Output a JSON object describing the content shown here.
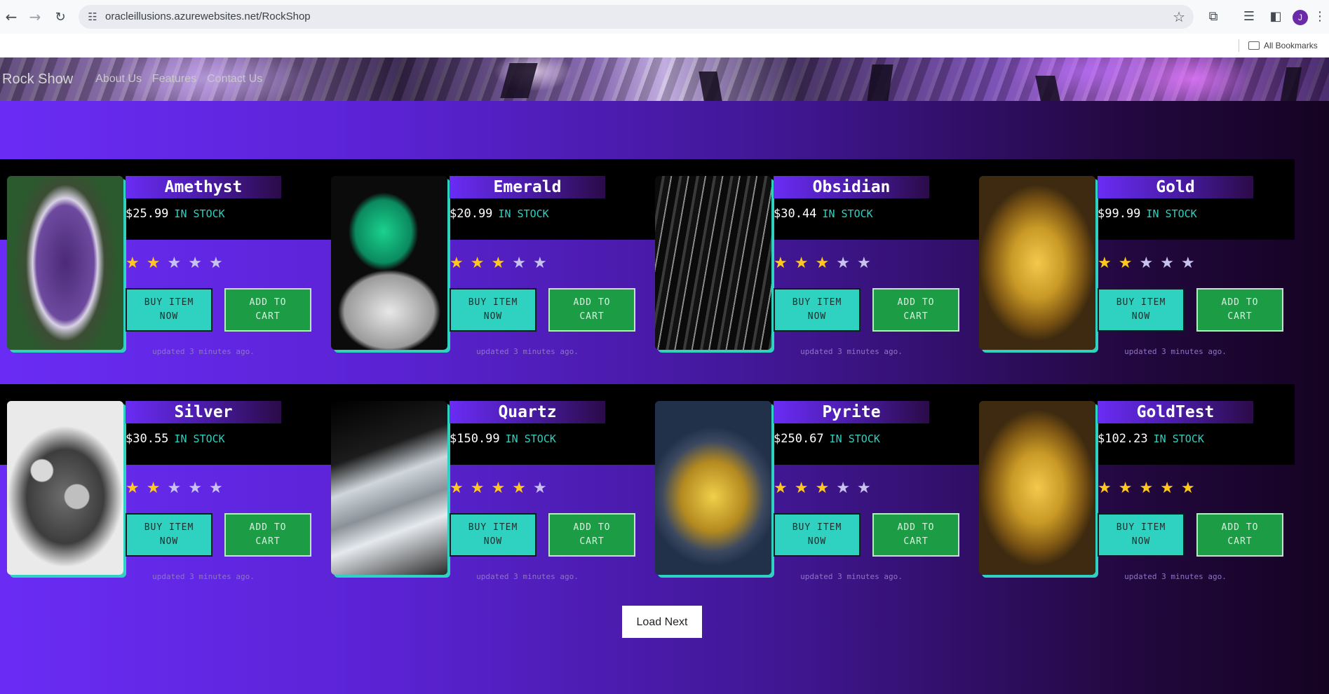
{
  "browser": {
    "url": "oracleillusions.azurewebsites.net/RockShop",
    "bookmarks_label": "All Bookmarks",
    "avatar_initial": "J",
    "icons": [
      "back-icon",
      "forward-icon",
      "reload-icon",
      "site-settings-icon",
      "bookmark-star-icon",
      "extensions-icon",
      "reading-list-icon",
      "side-panel-icon",
      "menu-icon"
    ]
  },
  "nav": {
    "brand": "Rock Show",
    "links": [
      "About Us",
      "Features",
      "Contact Us"
    ]
  },
  "products": [
    {
      "name": "Amethyst",
      "price": "$25.99",
      "stock": "IN STOCK",
      "rating": 2,
      "buy": "BUY ITEM NOW",
      "cart": "ADD TO CART",
      "updated": "updated 3 minutes ago."
    },
    {
      "name": "Emerald",
      "price": "$20.99",
      "stock": "IN STOCK",
      "rating": 3,
      "buy": "BUY ITEM NOW",
      "cart": "ADD TO CART",
      "updated": "updated 3 minutes ago."
    },
    {
      "name": "Obsidian",
      "price": "$30.44",
      "stock": "IN STOCK",
      "rating": 3,
      "buy": "BUY ITEM NOW",
      "cart": "ADD TO CART",
      "updated": "updated 3 minutes ago."
    },
    {
      "name": "Gold",
      "price": "$99.99",
      "stock": "IN STOCK",
      "rating": 2,
      "buy": "BUY ITEM NOW",
      "cart": "ADD TO CART",
      "updated": "updated 3 minutes ago."
    },
    {
      "name": "Silver",
      "price": "$30.55",
      "stock": "IN STOCK",
      "rating": 2,
      "buy": "BUY ITEM NOW",
      "cart": "ADD TO CART",
      "updated": "updated 3 minutes ago."
    },
    {
      "name": "Quartz",
      "price": "$150.99",
      "stock": "IN STOCK",
      "rating": 4,
      "buy": "BUY ITEM NOW",
      "cart": "ADD TO CART",
      "updated": "updated 3 minutes ago."
    },
    {
      "name": "Pyrite",
      "price": "$250.67",
      "stock": "IN STOCK",
      "rating": 3,
      "buy": "BUY ITEM NOW",
      "cart": "ADD TO CART",
      "updated": "updated 3 minutes ago."
    },
    {
      "name": "GoldTest",
      "price": "$102.23",
      "stock": "IN STOCK",
      "rating": 5,
      "buy": "BUY ITEM NOW",
      "cart": "ADD TO CART",
      "updated": "updated 3 minutes ago."
    }
  ],
  "load_next": "Load Next",
  "colors": {
    "accent_teal": "#2fd2c0",
    "cart_green": "#1b9c45",
    "star_gold": "#ffc81a",
    "page_purple": "#6a2cf5"
  }
}
